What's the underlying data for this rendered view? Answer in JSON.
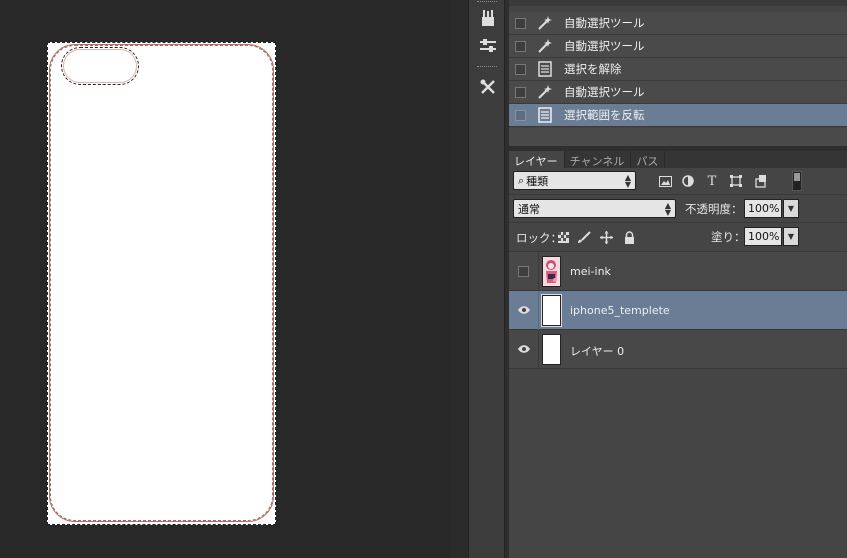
{
  "history": {
    "items": [
      {
        "label": "自動選択ツール",
        "icon": "magic-wand-icon",
        "selected": false
      },
      {
        "label": "自動選択ツール",
        "icon": "magic-wand-icon",
        "selected": false
      },
      {
        "label": "選択を解除",
        "icon": "document-icon",
        "selected": false
      },
      {
        "label": "自動選択ツール",
        "icon": "magic-wand-icon",
        "selected": false
      },
      {
        "label": "選択範囲を反転",
        "icon": "document-icon",
        "selected": true
      }
    ]
  },
  "layers_panel": {
    "tabs": [
      "レイヤー",
      "チャンネル",
      "パス"
    ],
    "active_tab": "レイヤー",
    "filter": {
      "label": "種類"
    },
    "blend_mode": "通常",
    "opacity_label": "不透明度：",
    "opacity_value": "100%",
    "lock_label": "ロック：",
    "fill_label": "塗り：",
    "fill_value": "100%",
    "layers": [
      {
        "name": "mei-ink",
        "visible": false,
        "selected": false
      },
      {
        "name": "iphone5_templete",
        "visible": true,
        "selected": true
      },
      {
        "name": "レイヤー 0",
        "visible": true,
        "selected": false
      }
    ]
  },
  "colors": {
    "selection_highlight": "#6a7d95",
    "panel_bg": "#454545",
    "canvas_bg": "#282828",
    "outline_red": "#c8685a"
  }
}
